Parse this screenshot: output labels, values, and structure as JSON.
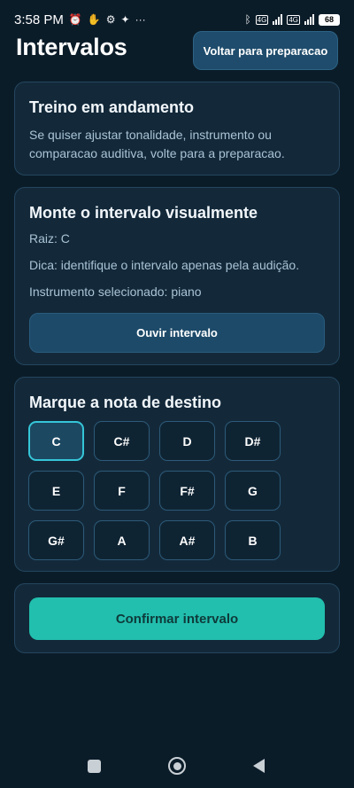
{
  "status_bar": {
    "time": "3:58 PM",
    "network_1": "4G",
    "network_2": "4G",
    "battery": "68",
    "more": "···"
  },
  "header": {
    "title": "Intervalos",
    "back_button": "Voltar para preparacao"
  },
  "training_card": {
    "title": "Treino em andamento",
    "description": "Se quiser ajustar tonalidade, instrumento ou comparacao auditiva, volte para a preparacao."
  },
  "interval_card": {
    "title": "Monte o intervalo visualmente",
    "root": "Raiz: C",
    "hint": "Dica: identifique o intervalo apenas pela audição.",
    "instrument": "Instrumento selecionado: piano",
    "listen_button": "Ouvir intervalo"
  },
  "notes_card": {
    "title": "Marque a nota de destino",
    "selected": "C",
    "notes": [
      "C",
      "C#",
      "D",
      "D#",
      "E",
      "F",
      "F#",
      "G",
      "G#",
      "A",
      "A#",
      "B"
    ]
  },
  "confirm": {
    "button": "Confirmar intervalo"
  },
  "colors": {
    "background": "#0b1c29",
    "card": "#13293a",
    "accent": "#22bfae",
    "selected_border": "#35c6d8",
    "button": "#1f4c6c"
  }
}
